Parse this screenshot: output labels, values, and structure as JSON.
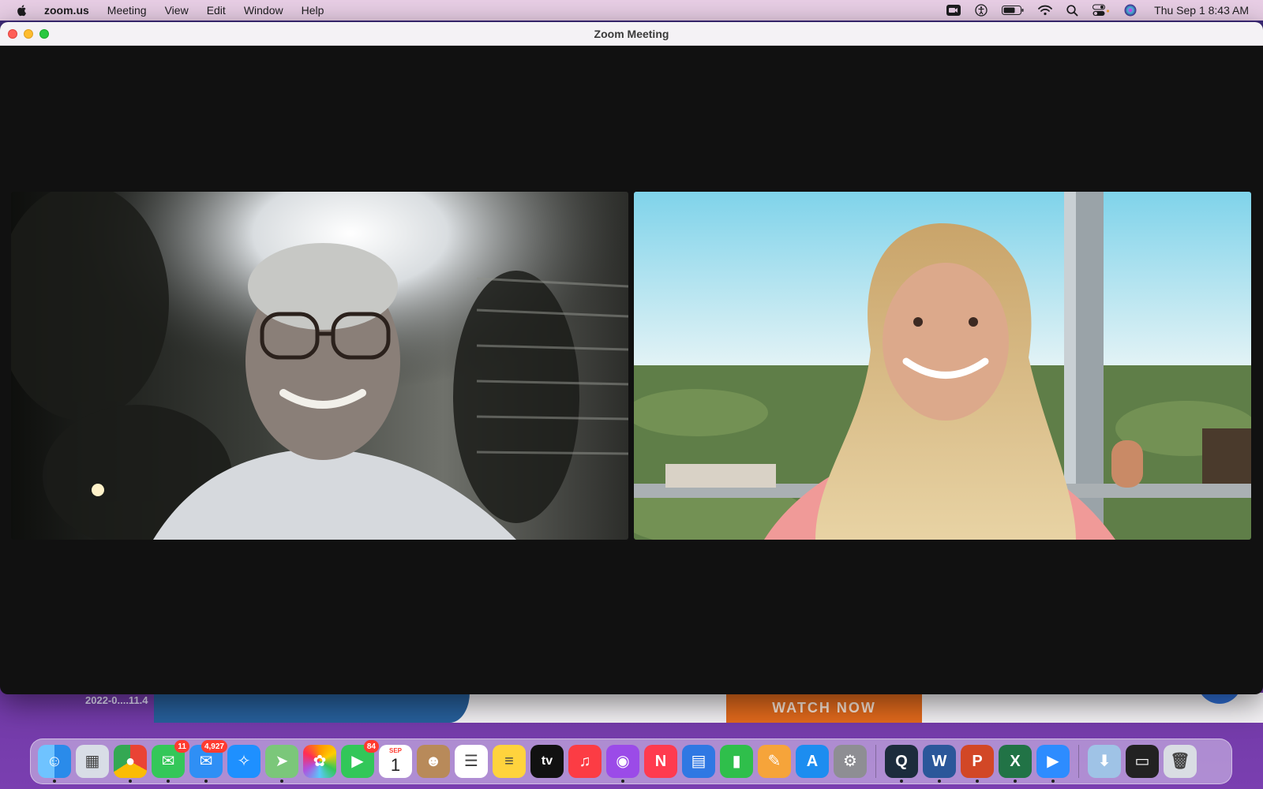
{
  "menubar": {
    "app_name": "zoom.us",
    "menus": [
      "Meeting",
      "View",
      "Edit",
      "Window",
      "Help"
    ],
    "status_icons": [
      "zoom-video-icon",
      "accessibility-icon",
      "battery-icon",
      "wifi-icon",
      "search-icon",
      "control-center-icon",
      "siri-icon"
    ],
    "clock": "Thu Sep 1  8:43 AM"
  },
  "window": {
    "title": "Zoom Meeting"
  },
  "background_page": {
    "cta_label": "WATCH NOW"
  },
  "desktop": {
    "file_label": "2022-0....11.4"
  },
  "dock": {
    "items": [
      {
        "name": "finder",
        "badge": "",
        "running": true
      },
      {
        "name": "launchpad",
        "badge": "",
        "running": false
      },
      {
        "name": "chrome",
        "badge": "",
        "running": true
      },
      {
        "name": "messages",
        "badge": "11",
        "running": true
      },
      {
        "name": "mail",
        "badge": "4,927",
        "running": true
      },
      {
        "name": "safari",
        "badge": "",
        "running": false
      },
      {
        "name": "maps",
        "badge": "",
        "running": true
      },
      {
        "name": "photos",
        "badge": "",
        "running": false
      },
      {
        "name": "facetime",
        "badge": "84",
        "running": false
      },
      {
        "name": "calendar",
        "badge": "",
        "running": false,
        "month": "SEP",
        "day": "1"
      },
      {
        "name": "contacts",
        "badge": "",
        "running": false
      },
      {
        "name": "reminders",
        "badge": "",
        "running": false
      },
      {
        "name": "notes",
        "badge": "",
        "running": false
      },
      {
        "name": "apple-tv",
        "badge": "",
        "running": false,
        "label": "tv"
      },
      {
        "name": "music",
        "badge": "",
        "running": false
      },
      {
        "name": "podcasts",
        "badge": "",
        "running": true
      },
      {
        "name": "news",
        "badge": "",
        "running": false
      },
      {
        "name": "keynote",
        "badge": "",
        "running": false
      },
      {
        "name": "numbers",
        "badge": "",
        "running": false
      },
      {
        "name": "pages",
        "badge": "",
        "running": false
      },
      {
        "name": "app-store",
        "badge": "",
        "running": false
      },
      {
        "name": "system-preferences",
        "badge": "",
        "running": false
      },
      {
        "name": "quicktime",
        "badge": "",
        "running": true
      },
      {
        "name": "word",
        "badge": "",
        "running": true
      },
      {
        "name": "powerpoint",
        "badge": "",
        "running": true
      },
      {
        "name": "excel",
        "badge": "",
        "running": true
      },
      {
        "name": "zoom",
        "badge": "",
        "running": true
      },
      {
        "name": "downloads-stack",
        "badge": "",
        "running": false
      },
      {
        "name": "screenshot-stack",
        "badge": "",
        "running": false
      },
      {
        "name": "trash",
        "badge": "",
        "running": false
      }
    ]
  },
  "colors": {
    "menubar": "#e9cfe6",
    "window_bg": "#111111",
    "cta": "#e36a1c"
  }
}
